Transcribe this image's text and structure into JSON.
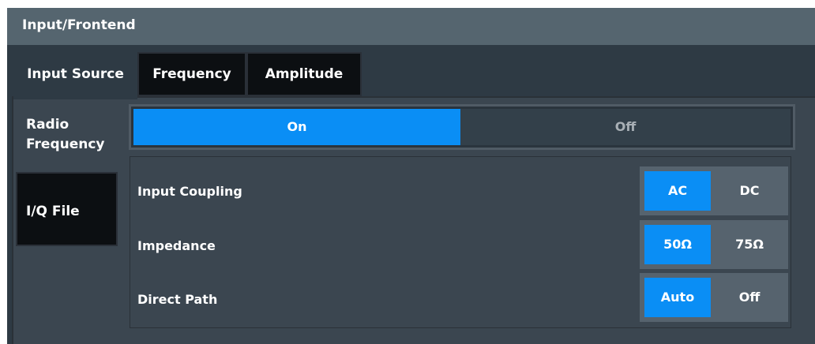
{
  "dialog": {
    "title": "Input/Frontend",
    "tabs": [
      {
        "label": "Input Source",
        "active": true
      },
      {
        "label": "Frequency",
        "active": false
      },
      {
        "label": "Amplitude",
        "active": false
      }
    ]
  },
  "source_tabs": [
    {
      "label_line1": "Radio",
      "label_line2": "Frequency",
      "active": true
    },
    {
      "label": "I/Q File",
      "active": false
    }
  ],
  "rf_toggle": {
    "on_label": "On",
    "off_label": "Off",
    "selected": "On"
  },
  "settings": [
    {
      "label": "Input Coupling",
      "options": [
        "AC",
        "DC"
      ],
      "selected": "AC"
    },
    {
      "label": "Impedance",
      "options": [
        "50Ω",
        "75Ω"
      ],
      "selected": "50Ω"
    },
    {
      "label": "Direct Path",
      "options": [
        "Auto",
        "Off"
      ],
      "selected": "Auto"
    }
  ],
  "colors": {
    "accent": "#0a8ef5",
    "title_bar": "#55656f",
    "panel": "#3b4650",
    "background": "#2e3a44"
  }
}
